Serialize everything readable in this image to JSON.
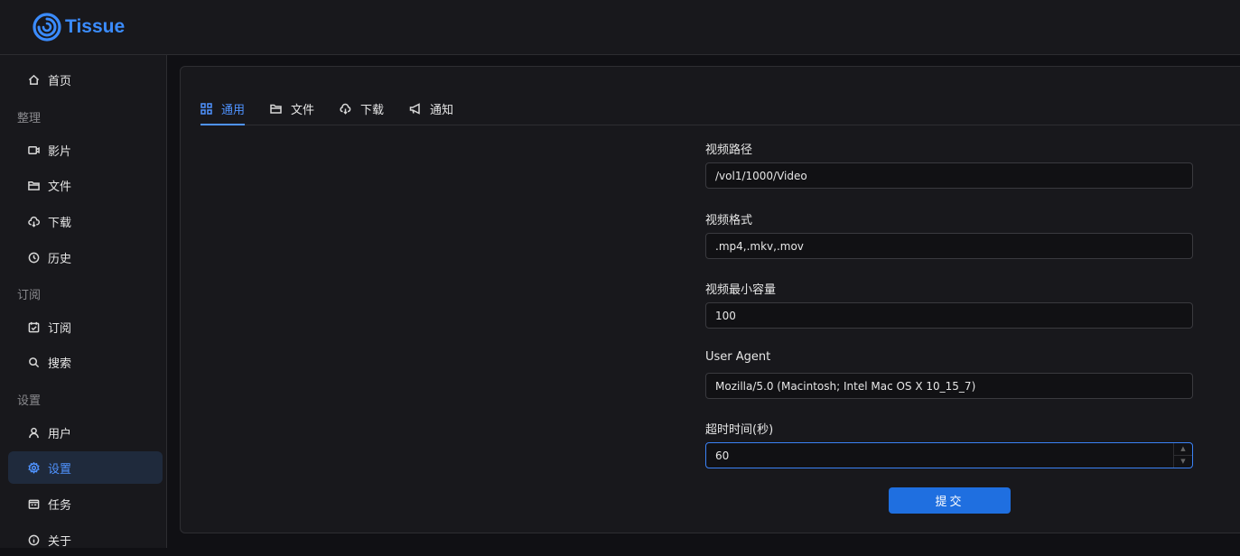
{
  "app": {
    "name": "Tissue",
    "brand_color": "#3b8cff"
  },
  "sidebar": {
    "top_item": {
      "label": "首页",
      "icon": "home-icon"
    },
    "groups": [
      {
        "label": "整理",
        "items": [
          {
            "label": "影片",
            "icon": "video-icon"
          },
          {
            "label": "文件",
            "icon": "folder-icon"
          },
          {
            "label": "下载",
            "icon": "cloud-download-icon"
          },
          {
            "label": "历史",
            "icon": "history-icon"
          }
        ]
      },
      {
        "label": "订阅",
        "items": [
          {
            "label": "订阅",
            "icon": "calendar-check-icon"
          },
          {
            "label": "搜索",
            "icon": "search-icon"
          }
        ]
      },
      {
        "label": "设置",
        "items": [
          {
            "label": "用户",
            "icon": "user-icon"
          },
          {
            "label": "设置",
            "icon": "gear-icon",
            "active": true
          },
          {
            "label": "任务",
            "icon": "task-icon"
          },
          {
            "label": "关于",
            "icon": "info-icon"
          }
        ]
      }
    ]
  },
  "tabs": [
    {
      "label": "通用",
      "icon": "grid-icon",
      "active": true
    },
    {
      "label": "文件",
      "icon": "folder-icon"
    },
    {
      "label": "下载",
      "icon": "cloud-download-icon"
    },
    {
      "label": "通知",
      "icon": "megaphone-icon"
    }
  ],
  "form": {
    "video_path": {
      "label": "视频路径",
      "value": "/vol1/1000/Video"
    },
    "video_format": {
      "label": "视频格式",
      "value": ".mp4,.mkv,.mov"
    },
    "video_min_size": {
      "label": "视频最小容量",
      "value": "100"
    },
    "user_agent": {
      "label": "User Agent",
      "value": "Mozilla/5.0 (Macintosh; Intel Mac OS X 10_15_7)"
    },
    "timeout": {
      "label": "超时时间(秒)",
      "value": "60"
    },
    "submit_label": "提交"
  },
  "colors": {
    "accent": "#4f93ff",
    "button": "#1f6fe0",
    "active_bg": "#1f2a3c"
  }
}
